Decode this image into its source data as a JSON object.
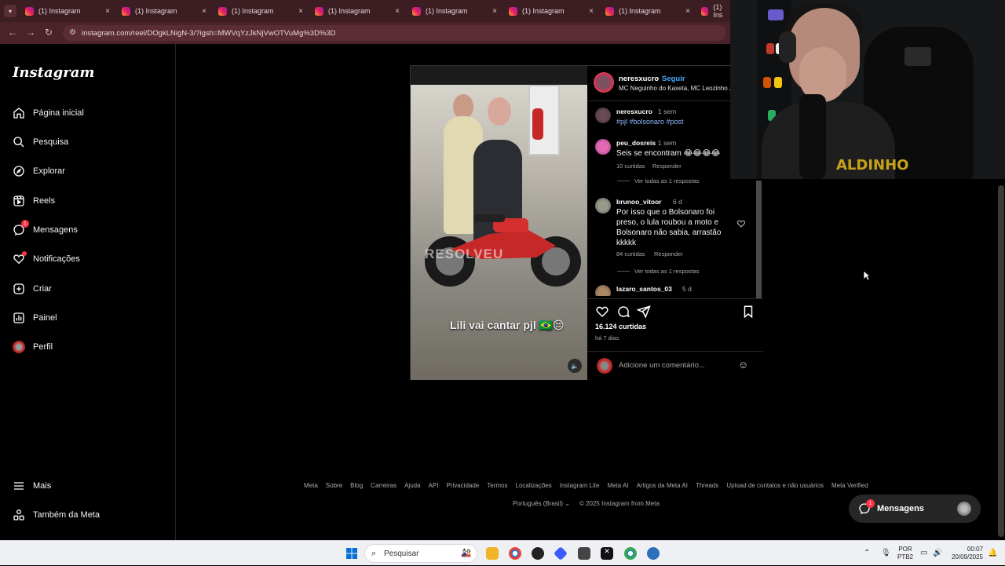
{
  "browser": {
    "tabs": [
      {
        "label": "(1) Instagram"
      },
      {
        "label": "(1) Instagram"
      },
      {
        "label": "(1) Instagram"
      },
      {
        "label": "(1) Instagram"
      },
      {
        "label": "(1) Instagram"
      },
      {
        "label": "(1) Instagram"
      },
      {
        "label": "(1) Instagram"
      },
      {
        "label": "(1) Ins"
      }
    ],
    "url": "instagram.com/reel/DOgkLNigN-3/?igsh=MWVqYzJkNjVwOTVuMg%3D%3D"
  },
  "sidebar": {
    "logo": "Instagram",
    "items": [
      {
        "label": "Página inicial",
        "icon": "home-icon"
      },
      {
        "label": "Pesquisa",
        "icon": "search-icon"
      },
      {
        "label": "Explorar",
        "icon": "compass-icon"
      },
      {
        "label": "Reels",
        "icon": "reels-icon"
      },
      {
        "label": "Mensagens",
        "icon": "messenger-icon",
        "badge": "1"
      },
      {
        "label": "Notificações",
        "icon": "heart-icon"
      },
      {
        "label": "Criar",
        "icon": "plus-icon"
      },
      {
        "label": "Painel",
        "icon": "dashboard-icon"
      },
      {
        "label": "Perfil",
        "icon": "avatar"
      }
    ],
    "more": "Mais",
    "meta": "Também da Meta"
  },
  "post": {
    "video_overlay_text": "RESOLVEU",
    "video_caption": "Lili vai cantar pjl 🇧🇷😔",
    "username": "neresxucro",
    "follow": "Seguir",
    "separator": "•",
    "audio": "MC Neguinho do Kaxeta, MC Leozinho Z",
    "caption": {
      "username": "neresxucro",
      "time": "1 sem",
      "text": "#pjl #bolsonaro #post"
    },
    "comments": [
      {
        "username": "peu_dosreis",
        "time": "1 sem",
        "text": "Seis se encontram 😂😂😂😂",
        "likes": "10 curtidas",
        "reply": "Responder",
        "view_replies": "Ver todas as 1 respostas"
      },
      {
        "username": "brunoo_vitoor",
        "time": "6 d",
        "text": "Por isso que o Bolsonaro foi preso, o lula roubou a moto e Bolsonaro não sabia, arrastão kkkkk",
        "likes": "84 curtidas",
        "reply": "Responder",
        "view_replies": "Ver todas as 1 respostas"
      },
      {
        "username": "lazaro_santos_03",
        "time": "5 d"
      }
    ],
    "likes": "16.124 curtidas",
    "ago": "há 7 dias",
    "comment_placeholder": "Adicione um comentário..."
  },
  "footer": {
    "links": [
      "Meta",
      "Sobre",
      "Blog",
      "Carreiras",
      "Ajuda",
      "API",
      "Privacidade",
      "Termos",
      "Localizações",
      "Instagram Lite",
      "Meta AI",
      "Artigos da Meta AI",
      "Threads",
      "Upload de contatos e não usuários",
      "Meta Verified"
    ],
    "language": "Português (Brasil)",
    "copyright": "© 2025 Instagram from Meta"
  },
  "messages_button": {
    "label": "Mensagens",
    "badge": "1"
  },
  "webcam": {
    "shirt_text": "ALDINHO"
  },
  "taskbar": {
    "search": "Pesquisar",
    "lang1": "POR",
    "lang2": "PTB2",
    "time": "00:07",
    "date": "20/09/2025"
  },
  "colors": {
    "accent": "#4aa8ff",
    "badge": "#ff3040",
    "chrome": "#3b1d22"
  }
}
